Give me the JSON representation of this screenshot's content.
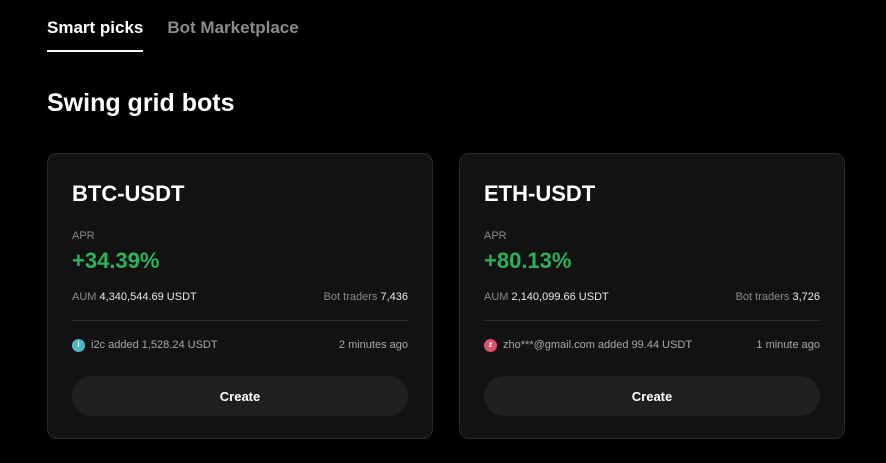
{
  "tabs": [
    {
      "label": "Smart picks",
      "active": true
    },
    {
      "label": "Bot Marketplace",
      "active": false
    }
  ],
  "section_title": "Swing grid bots",
  "colors": {
    "positive": "#2bb15a",
    "avatar_i2c": "#4fb6c8",
    "avatar_zho": "#e0506a"
  },
  "cards": [
    {
      "pair": "BTC-USDT",
      "apr_label": "APR",
      "apr_value": "+34.39%",
      "aum_label": "AUM",
      "aum_value": "4,340,544.69 USDT",
      "traders_label": "Bot traders",
      "traders_value": "7,436",
      "activity_avatar": "i",
      "activity_text": "i2c added 1,528.24 USDT",
      "activity_time": "2 minutes ago",
      "button_label": "Create"
    },
    {
      "pair": "ETH-USDT",
      "apr_label": "APR",
      "apr_value": "+80.13%",
      "aum_label": "AUM",
      "aum_value": "2,140,099.66 USDT",
      "traders_label": "Bot traders",
      "traders_value": "3,726",
      "activity_avatar": "z",
      "activity_text": "zho***@gmail.com added 99.44 USDT",
      "activity_time": "1 minute ago",
      "button_label": "Create"
    }
  ]
}
